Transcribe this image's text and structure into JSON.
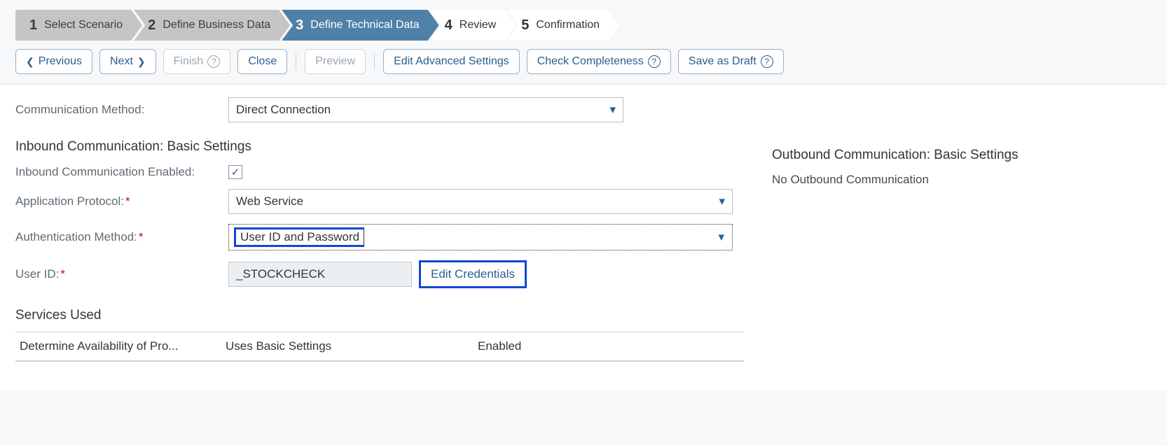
{
  "steps": [
    {
      "num": "1",
      "label": "Select Scenario"
    },
    {
      "num": "2",
      "label": "Define Business Data"
    },
    {
      "num": "3",
      "label": "Define Technical Data"
    },
    {
      "num": "4",
      "label": "Review"
    },
    {
      "num": "5",
      "label": "Confirmation"
    }
  ],
  "toolbar": {
    "previous": "Previous",
    "next": "Next",
    "finish": "Finish",
    "close": "Close",
    "preview": "Preview",
    "edit_adv": "Edit Advanced Settings",
    "check": "Check Completeness",
    "draft": "Save as Draft"
  },
  "comm_method": {
    "label": "Communication Method:",
    "value": "Direct Connection"
  },
  "inbound": {
    "heading": "Inbound Communication: Basic Settings",
    "enabled_label": "Inbound Communication Enabled:",
    "enabled_checked": true,
    "app_proto_label": "Application Protocol:",
    "app_proto_value": "Web Service",
    "auth_label": "Authentication Method:",
    "auth_value": "User ID and Password",
    "userid_label": "User ID:",
    "userid_value": "_STOCKCHECK",
    "edit_cred": "Edit Credentials"
  },
  "services": {
    "heading": "Services Used",
    "rows": [
      {
        "name": "Determine Availability of Pro...",
        "uses": "Uses Basic Settings",
        "status": "Enabled"
      }
    ]
  },
  "outbound": {
    "heading": "Outbound Communication: Basic Settings",
    "text": "No Outbound Communication"
  }
}
